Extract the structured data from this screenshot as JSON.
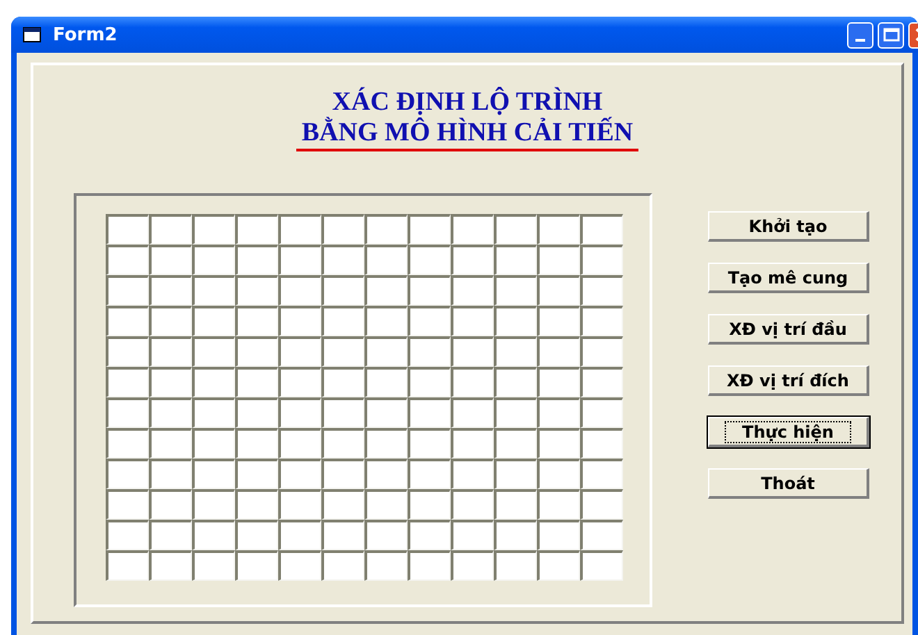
{
  "window": {
    "title": "Form2"
  },
  "heading": {
    "lines": [
      "XÁC ĐỊNH LỘ TRÌNH",
      "BẰNG MÔ HÌNH CẢI TIẾN"
    ]
  },
  "grid": {
    "rows": [
      {
        "cells": [
          {
            "filled": false
          },
          {
            "filled": false
          },
          {
            "filled": false
          },
          {
            "filled": false
          },
          {
            "filled": false
          },
          {
            "filled": false
          },
          {
            "filled": false
          },
          {
            "filled": false
          },
          {
            "filled": false
          },
          {
            "filled": false
          },
          {
            "filled": false
          },
          {
            "filled": false
          }
        ]
      },
      {
        "cells": [
          {
            "filled": false
          },
          {
            "filled": false
          },
          {
            "filled": false
          },
          {
            "filled": false
          },
          {
            "filled": false
          },
          {
            "filled": false
          },
          {
            "filled": false
          },
          {
            "filled": false
          },
          {
            "filled": false
          },
          {
            "filled": false
          },
          {
            "filled": false
          },
          {
            "filled": false
          }
        ]
      },
      {
        "cells": [
          {
            "filled": false
          },
          {
            "filled": false
          },
          {
            "filled": false
          },
          {
            "filled": false
          },
          {
            "filled": false
          },
          {
            "filled": false
          },
          {
            "filled": false
          },
          {
            "filled": false
          },
          {
            "filled": false
          },
          {
            "filled": false
          },
          {
            "filled": false
          },
          {
            "filled": false
          }
        ]
      },
      {
        "cells": [
          {
            "filled": false
          },
          {
            "filled": false
          },
          {
            "filled": false
          },
          {
            "filled": false
          },
          {
            "filled": false
          },
          {
            "filled": false
          },
          {
            "filled": false
          },
          {
            "filled": false
          },
          {
            "filled": false
          },
          {
            "filled": false
          },
          {
            "filled": false
          },
          {
            "filled": false
          }
        ]
      },
      {
        "cells": [
          {
            "filled": false
          },
          {
            "filled": false
          },
          {
            "filled": false
          },
          {
            "filled": false
          },
          {
            "filled": false
          },
          {
            "filled": false
          },
          {
            "filled": false
          },
          {
            "filled": false
          },
          {
            "filled": false
          },
          {
            "filled": false
          },
          {
            "filled": false
          },
          {
            "filled": false
          }
        ]
      },
      {
        "cells": [
          {
            "filled": false
          },
          {
            "filled": false
          },
          {
            "filled": false
          },
          {
            "filled": false
          },
          {
            "filled": false
          },
          {
            "filled": false
          },
          {
            "filled": false
          },
          {
            "filled": false
          },
          {
            "filled": false
          },
          {
            "filled": false
          },
          {
            "filled": false
          },
          {
            "filled": false
          }
        ]
      },
      {
        "cells": [
          {
            "filled": false
          },
          {
            "filled": false
          },
          {
            "filled": false
          },
          {
            "filled": false
          },
          {
            "filled": false
          },
          {
            "filled": false
          },
          {
            "filled": false
          },
          {
            "filled": false
          },
          {
            "filled": false
          },
          {
            "filled": false
          },
          {
            "filled": false
          },
          {
            "filled": false
          }
        ]
      },
      {
        "cells": [
          {
            "filled": false
          },
          {
            "filled": false
          },
          {
            "filled": false
          },
          {
            "filled": false
          },
          {
            "filled": false
          },
          {
            "filled": false
          },
          {
            "filled": false
          },
          {
            "filled": false
          },
          {
            "filled": false
          },
          {
            "filled": false
          },
          {
            "filled": false
          },
          {
            "filled": false
          }
        ]
      },
      {
        "cells": [
          {
            "filled": false
          },
          {
            "filled": false
          },
          {
            "filled": false
          },
          {
            "filled": false
          },
          {
            "filled": false
          },
          {
            "filled": false
          },
          {
            "filled": false
          },
          {
            "filled": false
          },
          {
            "filled": false
          },
          {
            "filled": false
          },
          {
            "filled": false
          },
          {
            "filled": false
          }
        ]
      },
      {
        "cells": [
          {
            "filled": false
          },
          {
            "filled": false
          },
          {
            "filled": false
          },
          {
            "filled": false
          },
          {
            "filled": false
          },
          {
            "filled": false
          },
          {
            "filled": false
          },
          {
            "filled": false
          },
          {
            "filled": false
          },
          {
            "filled": false
          },
          {
            "filled": false
          },
          {
            "filled": false
          }
        ]
      },
      {
        "cells": [
          {
            "filled": false
          },
          {
            "filled": false
          },
          {
            "filled": false
          },
          {
            "filled": false
          },
          {
            "filled": false
          },
          {
            "filled": false
          },
          {
            "filled": false
          },
          {
            "filled": false
          },
          {
            "filled": false
          },
          {
            "filled": false
          },
          {
            "filled": false
          },
          {
            "filled": false
          }
        ]
      },
      {
        "cells": [
          {
            "filled": false
          },
          {
            "filled": false
          },
          {
            "filled": false
          },
          {
            "filled": false
          },
          {
            "filled": false
          },
          {
            "filled": false
          },
          {
            "filled": false
          },
          {
            "filled": false
          },
          {
            "filled": false
          },
          {
            "filled": false
          },
          {
            "filled": false
          },
          {
            "filled": false
          }
        ]
      }
    ]
  },
  "buttons": [
    {
      "label": "Khởi tạo",
      "focused": false
    },
    {
      "label": "Tạo mê cung",
      "focused": false
    },
    {
      "label": "XĐ vị trí đầu",
      "focused": false
    },
    {
      "label": "XĐ vị trí đích",
      "focused": false
    },
    {
      "label": "Thực hiện",
      "focused": true
    },
    {
      "label": "Thoát",
      "focused": false
    }
  ]
}
